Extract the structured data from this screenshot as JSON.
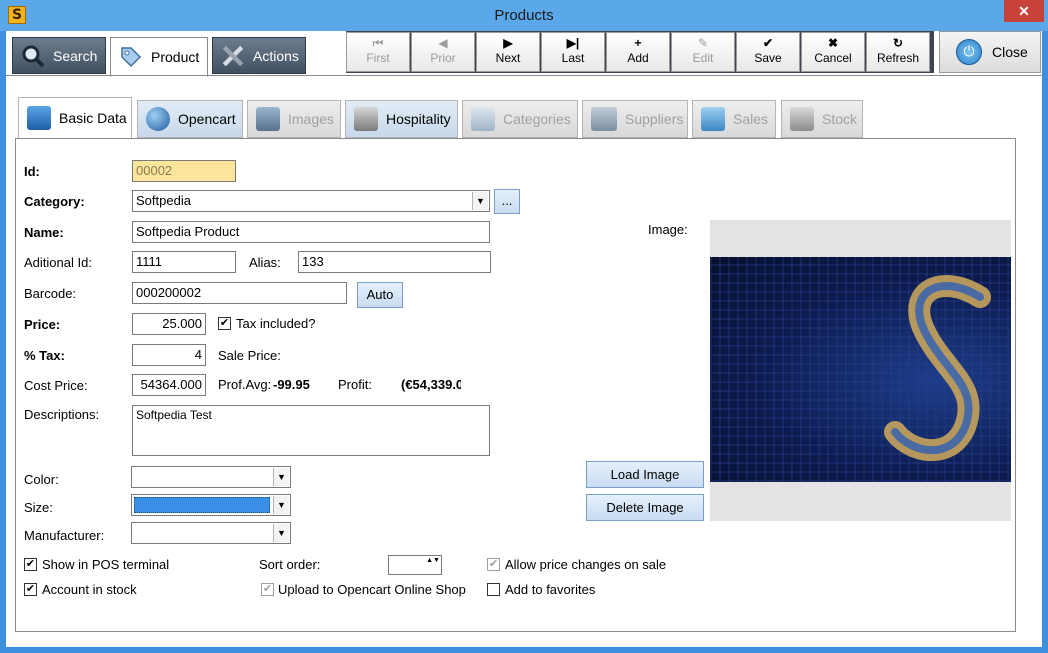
{
  "window": {
    "title": "Products",
    "app_icon": "S",
    "close_glyph": "✕"
  },
  "main_tabs": [
    {
      "label": "Search",
      "icon": "magnifier-icon"
    },
    {
      "label": "Product",
      "icon": "tag-icon"
    },
    {
      "label": "Actions",
      "icon": "tools-icon"
    }
  ],
  "toolbar": {
    "first": {
      "label": "First",
      "glyph": "⏮"
    },
    "prior": {
      "label": "Prior",
      "glyph": "◀"
    },
    "next": {
      "label": "Next",
      "glyph": "▶"
    },
    "last": {
      "label": "Last",
      "glyph": "▶|"
    },
    "add": {
      "label": "Add",
      "glyph": "+"
    },
    "edit": {
      "label": "Edit",
      "glyph": "✎"
    },
    "save": {
      "label": "Save",
      "glyph": "✔"
    },
    "cancel": {
      "label": "Cancel",
      "glyph": "✖"
    },
    "refresh": {
      "label": "Refresh",
      "glyph": "↻"
    }
  },
  "close_button": {
    "label": "Close",
    "glyph": "⏻"
  },
  "sub_tabs": [
    {
      "label": "Basic Data",
      "enabled": true
    },
    {
      "label": "Opencart",
      "enabled": true
    },
    {
      "label": "Images",
      "enabled": false
    },
    {
      "label": "Hospitality",
      "enabled": true
    },
    {
      "label": "Categories",
      "enabled": false
    },
    {
      "label": "Suppliers",
      "enabled": false
    },
    {
      "label": "Sales",
      "enabled": false
    },
    {
      "label": "Stock",
      "enabled": false
    }
  ],
  "form": {
    "id_label": "Id:",
    "id_value": "00002",
    "category_label": "Category:",
    "category_value": "Softpedia",
    "category_more": "...",
    "name_label": "Name:",
    "name_value": "Softpedia Product",
    "additional_id_label": "Aditional Id:",
    "additional_id_value": "1111",
    "alias_label": "Alias:",
    "alias_value": "133",
    "barcode_label": "Barcode:",
    "barcode_value": "000200002",
    "auto_label": "Auto",
    "price_label": "Price:",
    "price_value": "25.000",
    "tax_included_label": "Tax included?",
    "tax_included": true,
    "tax_label": "% Tax:",
    "tax_value": "4",
    "sale_price_label": "Sale Price:",
    "cost_price_label": "Cost Price:",
    "cost_price_value": "54364.000",
    "prof_avg_label": "Prof.Avg:",
    "prof_avg_value": "-99.95",
    "profit_label": "Profit:",
    "profit_value": "(€54,339.0",
    "descriptions_label": "Descriptions:",
    "descriptions_value": "Softpedia Test",
    "color_label": "Color:",
    "size_label": "Size:",
    "manufacturer_label": "Manufacturer:",
    "image_label": "Image:",
    "load_image_label": "Load Image",
    "delete_image_label": "Delete Image",
    "show_pos_label": "Show in POS terminal",
    "account_stock_label": "Account in stock",
    "sort_order_label": "Sort order:",
    "upload_opencart_label": "Upload to Opencart Online Shop",
    "allow_price_label": "Allow price changes on sale",
    "add_favorites_label": "Add to favorites",
    "checkmark": "✔",
    "dropdown_arrow": "▼",
    "spinner_arrows": "▲▼"
  },
  "colors": {
    "title_bar": "#5aa8ea",
    "toolbar_dark": "#3b4652",
    "id_field": "#fbe59a",
    "size_selected": "#3a8ee6"
  }
}
